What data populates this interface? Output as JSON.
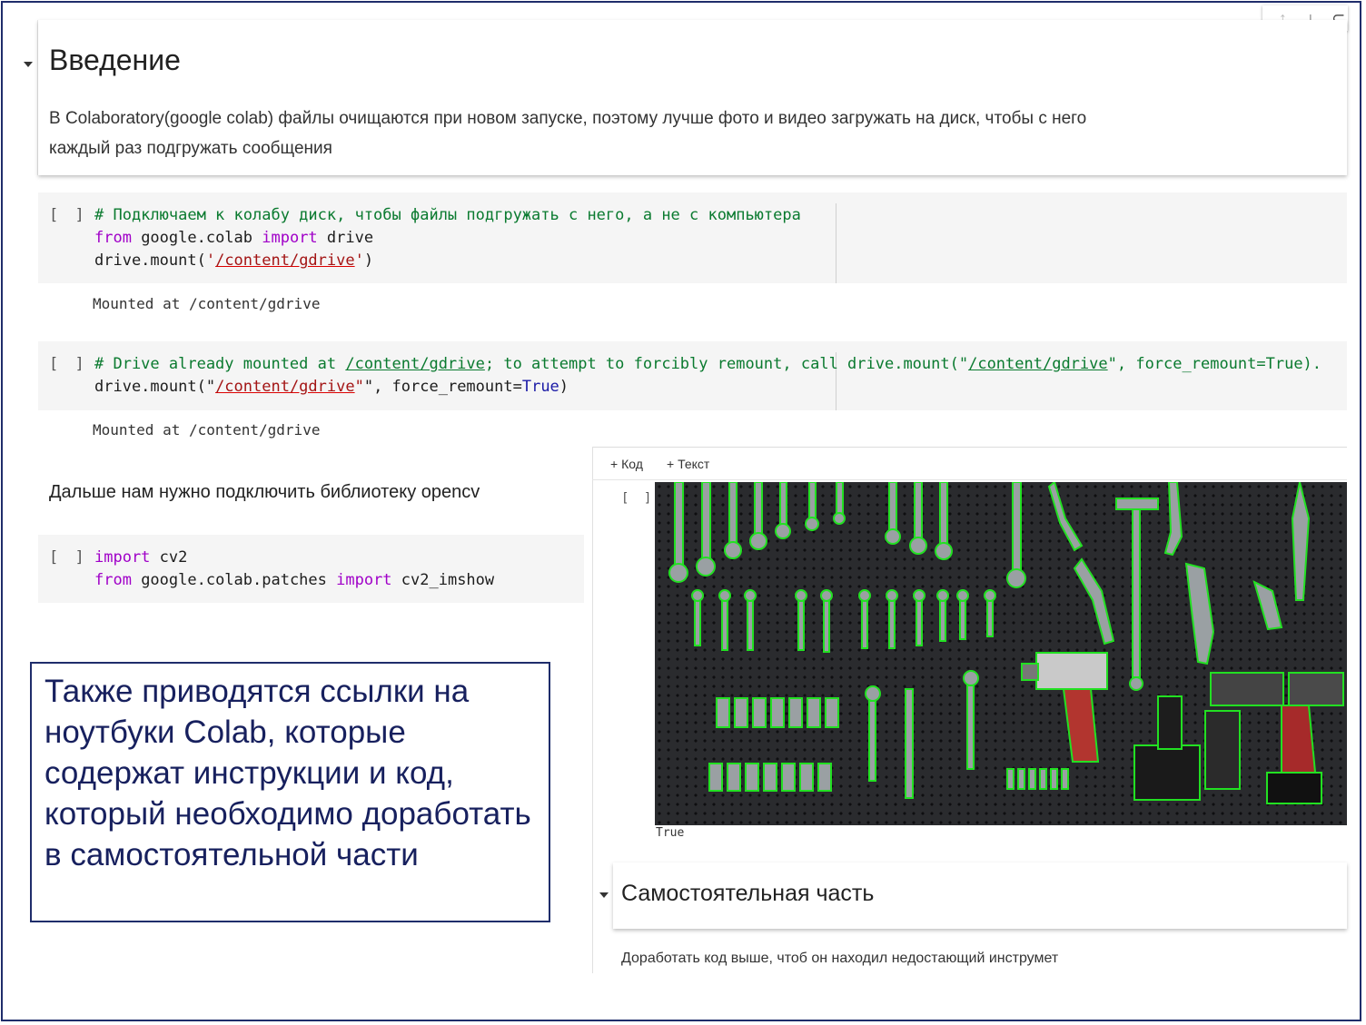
{
  "toolbar": {
    "move_up_icon": "↑",
    "move_down_icon": "↓",
    "link_icon": "⊂"
  },
  "intro": {
    "heading": "Введение",
    "text_line1": "В Colaboratory(google colab) файлы очищаются при новом запуске, поэтому лучше фото и видео загружать на диск, чтобы с него",
    "text_line2": "каждый раз подгружать сообщения"
  },
  "cell1": {
    "bracket": "[ ]",
    "comment": "# Подключаем к колабу диск, чтобы файлы подгружать с него, а не с компьютера",
    "l2_kw1": "from",
    "l2_mod": " google.colab ",
    "l2_kw2": "import",
    "l2_name": " drive",
    "l3_a": "drive.mount(",
    "l3_q1": "'",
    "l3_path": "/content/gdrive",
    "l3_q2": "'",
    "l3_b": ")",
    "output": "Mounted at /content/gdrive"
  },
  "cell2": {
    "bracket": "[ ]",
    "l1_a": "# Drive already mounted at ",
    "l1_path1": "/content/gdrive",
    "l1_b": "; to attempt to forcibly remount, call drive.mount(\"",
    "l1_path2": "/content/gdrive",
    "l1_c": "\", force_remount=True).",
    "l2_a": "drive.mount(\"",
    "l2_path": "/content/gdrive",
    "l2_b": "\", force_remount=",
    "l2_true": "True",
    "l2_c": ")",
    "output": "Mounted at /content/gdrive"
  },
  "opencv_text": "Дальше нам нужно подключить библиотеку opencv",
  "cell3": {
    "bracket": "[ ]",
    "l1_kw": "import",
    "l1_rest": " cv2",
    "l2_kw1": "from",
    "l2_mod": " google.colab.patches ",
    "l2_kw2": "import",
    "l2_rest": " cv2_imshow"
  },
  "callout": {
    "text": "Также приводятся ссылки на ноутбуки Colab, которые содержат инструкции и код, который необходимо доработать в самостоятельной части"
  },
  "right_panel": {
    "add_code": "+ Код",
    "add_text": "+ Текст",
    "bracket": "[ ]",
    "image_output": "True",
    "section_title": "Самостоятельная часть",
    "section_text": "Доработать код выше, чтоб он находил недостающий инструмет"
  },
  "colors": {
    "comment": "#0a7a2f",
    "keyword": "#a000c8",
    "string": "#a31515",
    "boolean": "#1a1aa6",
    "callout_border": "#1f2d6b",
    "contour": "#22e022"
  }
}
